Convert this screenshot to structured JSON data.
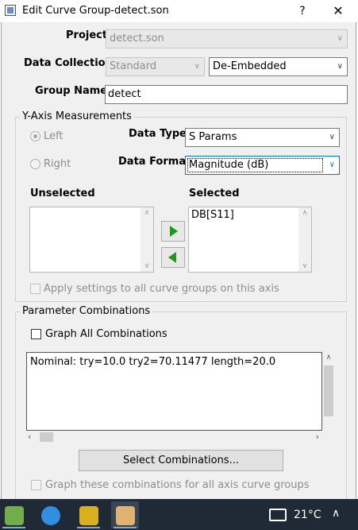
{
  "window": {
    "title": "Edit Curve Group-detect.son",
    "help_glyph": "?",
    "close_glyph": "✕"
  },
  "project": {
    "label": "Project",
    "value": "detect.son"
  },
  "data_collection": {
    "label": "Data Collection",
    "value": "Standard",
    "embed_value": "De-Embedded"
  },
  "group_name": {
    "label": "Group Name",
    "value": "detect"
  },
  "y_axis": {
    "title": "Y-Axis Measurements",
    "left_label": "Left",
    "right_label": "Right",
    "data_type_label": "Data Type",
    "data_type_value": "S Params",
    "data_format_label": "Data Format",
    "data_format_value": "Magnitude (dB)",
    "unselected_label": "Unselected",
    "selected_label": "Selected",
    "selected_items": [
      "DB[S11]"
    ],
    "apply_all_label": "Apply settings to all curve groups on this axis"
  },
  "params": {
    "title": "Parameter Combinations",
    "graph_all_label": "Graph All Combinations",
    "combinations": [
      "Nominal: try=10.0 try2=70.11477 length=20.0"
    ],
    "select_button_label": "Select Combinations...",
    "graph_these_label": "Graph these combinations for all axis curve groups"
  },
  "taskbar": {
    "apps": [
      "notepad-plus-icon",
      "browser-bird-icon",
      "em-app-icon",
      "sonnet-app-icon"
    ],
    "temperature": "21°C"
  },
  "colors": {
    "arrow_green": "#1c9a1c",
    "taskbar": "#202a36",
    "focus": "#0078d7"
  }
}
